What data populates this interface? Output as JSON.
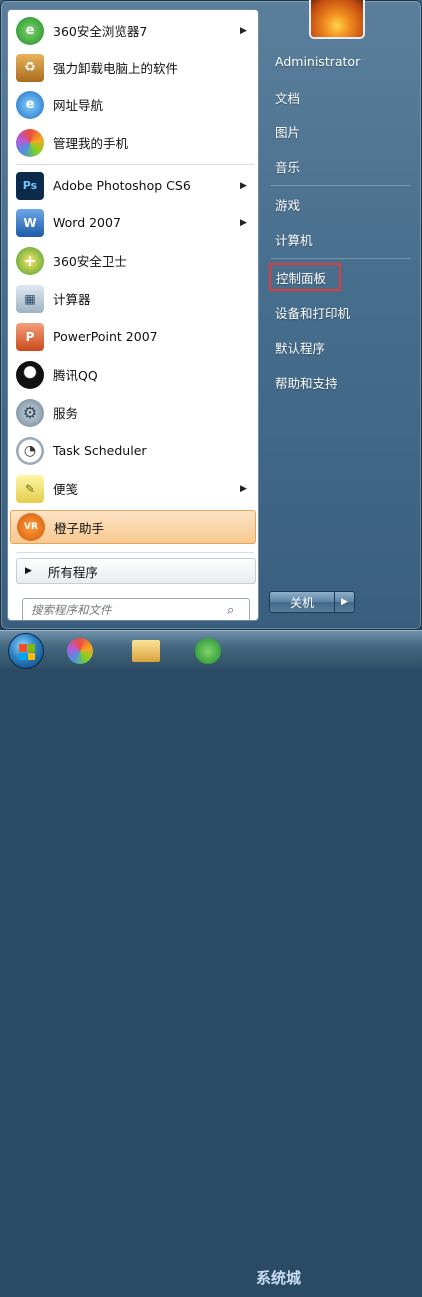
{
  "left_menu": {
    "items": [
      {
        "label": "360安全浏览器7",
        "arrow": true,
        "icon": "360-browser-icon"
      },
      {
        "label": "强力卸载电脑上的软件",
        "arrow": false,
        "icon": "uninstall-icon"
      },
      {
        "label": "网址导航",
        "arrow": false,
        "icon": "ie-icon"
      },
      {
        "label": "管理我的手机",
        "arrow": false,
        "icon": "phone-manager-icon"
      },
      {
        "label": "Adobe Photoshop CS6",
        "arrow": true,
        "icon": "photoshop-icon"
      },
      {
        "label": "Word 2007",
        "arrow": true,
        "icon": "word-icon"
      },
      {
        "label": "360安全卫士",
        "arrow": false,
        "icon": "360-security-icon"
      },
      {
        "label": "计算器",
        "arrow": false,
        "icon": "calculator-icon"
      },
      {
        "label": "PowerPoint 2007",
        "arrow": false,
        "icon": "powerpoint-icon"
      },
      {
        "label": "腾讯QQ",
        "arrow": false,
        "icon": "qq-icon"
      },
      {
        "label": "服务",
        "arrow": false,
        "icon": "services-icon"
      },
      {
        "label": "Task Scheduler",
        "arrow": false,
        "icon": "clock-icon"
      },
      {
        "label": "便笺",
        "arrow": true,
        "icon": "sticky-notes-icon"
      },
      {
        "label": "橙子助手",
        "arrow": false,
        "icon": "orange-helper-icon"
      }
    ],
    "all_programs": "所有程序",
    "search_placeholder": "搜索程序和文件"
  },
  "right_menu": {
    "items": [
      "Administrator",
      "文档",
      "图片",
      "音乐",
      "游戏",
      "计算机",
      "控制面板",
      "设备和打印机",
      "默认程序",
      "帮助和支持"
    ],
    "highlighted": "控制面板"
  },
  "shutdown": {
    "label": "关机"
  },
  "watermark": "系统城",
  "colors": {
    "highlight_border": "#e23b3b",
    "hover": "#f7c98f"
  }
}
